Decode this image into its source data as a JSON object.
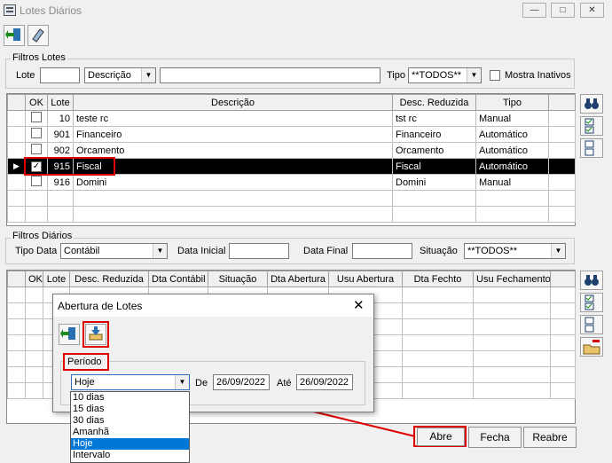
{
  "window": {
    "title": "Lotes Diários"
  },
  "filtros_lotes": {
    "group_label": "Filtros Lotes",
    "lote_label": "Lote",
    "descricao_combo": "Descrição",
    "tipo_label": "Tipo",
    "tipo_value": "**TODOS**",
    "mostra_inativos_label": "Mostra Inativos"
  },
  "lotes_grid": {
    "headers": [
      "OK",
      "Lote",
      "Descrição",
      "Desc. Reduzida",
      "Tipo"
    ],
    "rows": [
      {
        "ok": false,
        "lote": "10",
        "descricao": "teste rc",
        "reduzida": "tst rc",
        "tipo": "Manual"
      },
      {
        "ok": false,
        "lote": "901",
        "descricao": "Financeiro",
        "reduzida": "Financeiro",
        "tipo": "Automático"
      },
      {
        "ok": false,
        "lote": "902",
        "descricao": "Orcamento",
        "reduzida": "Orcamento",
        "tipo": "Automático"
      },
      {
        "ok": true,
        "lote": "915",
        "descricao": "Fiscal",
        "reduzida": "Fiscal",
        "tipo": "Automático"
      },
      {
        "ok": false,
        "lote": "916",
        "descricao": "Domini",
        "reduzida": "Domini",
        "tipo": "Manual"
      }
    ]
  },
  "filtros_diarios": {
    "group_label": "Filtros Diários",
    "tipo_data_label": "Tipo Data",
    "tipo_data_value": "Contábil",
    "data_inicial_label": "Data Inicial",
    "data_final_label": "Data Final",
    "situacao_label": "Situação",
    "situacao_value": "**TODOS**"
  },
  "diarios_grid": {
    "headers": [
      "OK",
      "Lote",
      "Desc. Reduzida",
      "Dta Contábil",
      "Situação",
      "Dta Abertura",
      "Usu Abertura",
      "Dta Fechto",
      "Usu Fechamento"
    ]
  },
  "buttons": {
    "abre": "Abre",
    "fecha": "Fecha",
    "reabre": "Reabre"
  },
  "dialog": {
    "title": "Abertura de Lotes",
    "periodo_label": "Período",
    "periodo_value": "Hoje",
    "de_label": "De",
    "de_value": "26/09/2022",
    "ate_label": "Até",
    "ate_value": "26/09/2022",
    "options": [
      "10 dias",
      "15 dias",
      "30 dias",
      "Amanhã",
      "Hoje",
      "Intervalo"
    ],
    "selected_option": "Hoje"
  }
}
